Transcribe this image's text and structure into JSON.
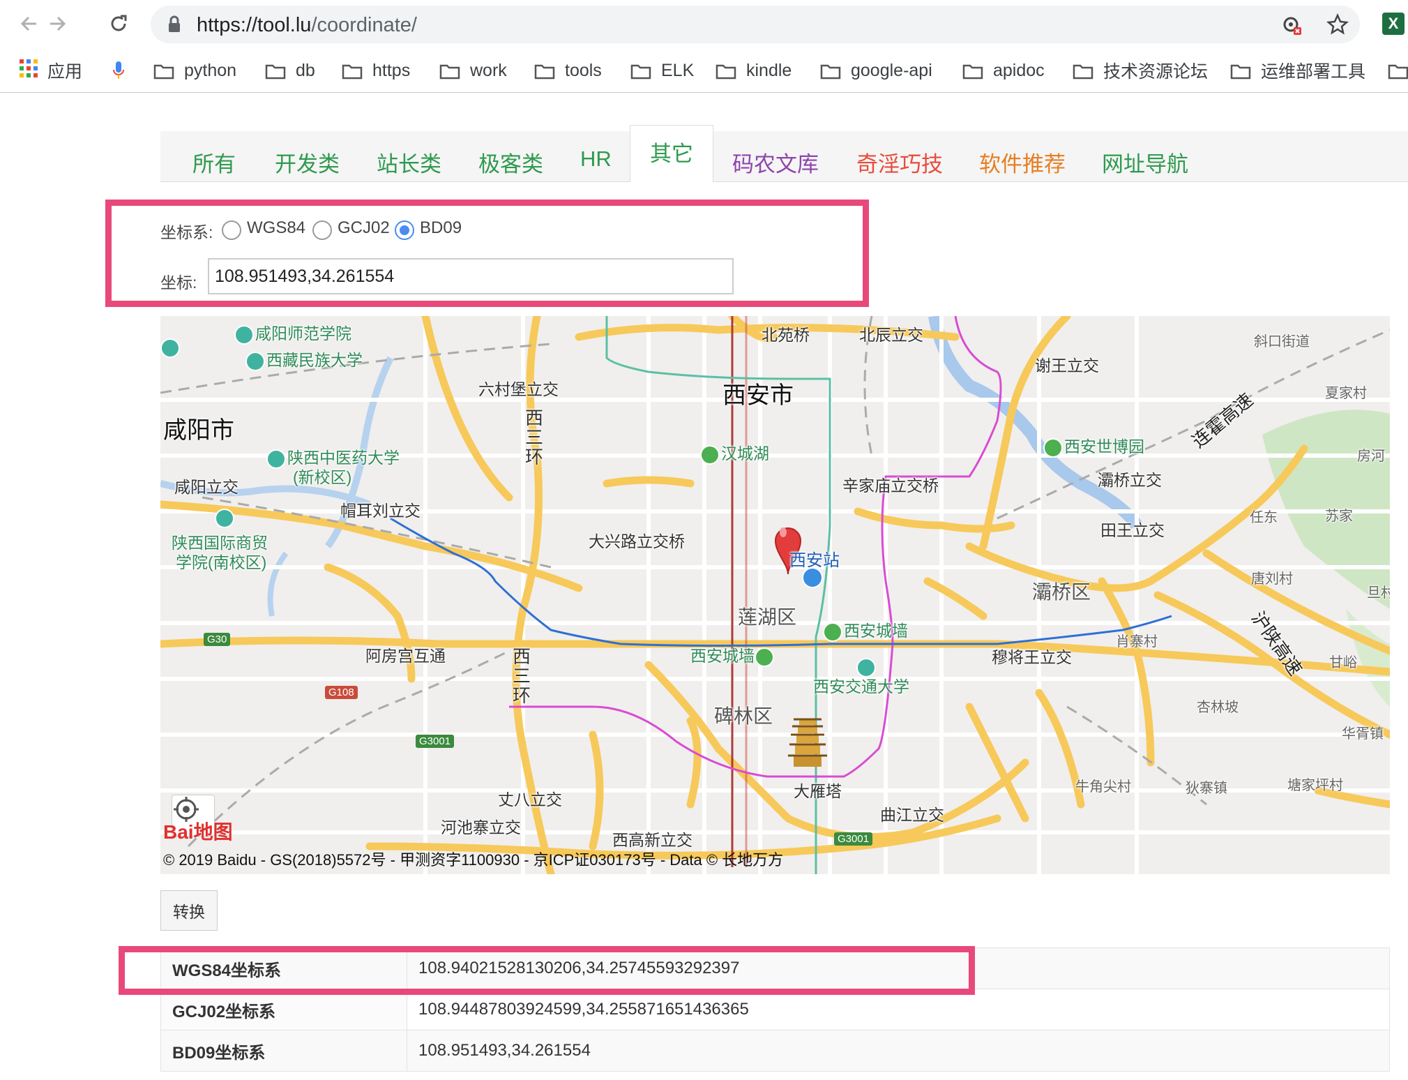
{
  "browser": {
    "url_host": "https://tool.lu",
    "url_path": "/coordinate/",
    "bookmarks": [
      "应用",
      "python",
      "db",
      "https",
      "work",
      "tools",
      "ELK",
      "kindle",
      "google-api",
      "apidoc",
      "技术资源论坛",
      "运维部署工具"
    ]
  },
  "tabs": [
    {
      "label": "所有",
      "color": "#2e9a4e"
    },
    {
      "label": "开发类",
      "color": "#2e9a4e"
    },
    {
      "label": "站长类",
      "color": "#2e9a4e"
    },
    {
      "label": "极客类",
      "color": "#2e9a4e"
    },
    {
      "label": "HR",
      "color": "#2e9a4e"
    },
    {
      "label": "其它",
      "color": "#2e9a4e"
    },
    {
      "label": "码农文库",
      "color": "#8e44ad"
    },
    {
      "label": "奇淫巧技",
      "color": "#e74c3c"
    },
    {
      "label": "软件推荐",
      "color": "#e67e22"
    },
    {
      "label": "网址导航",
      "color": "#2e9a4e"
    }
  ],
  "form": {
    "system_label": "坐标系:",
    "options": [
      "WGS84",
      "GCJ02",
      "BD09"
    ],
    "selected": "BD09",
    "coord_label": "坐标:",
    "coord_value": "108.951493,34.261554"
  },
  "map": {
    "labels": {
      "xianyang_normal": "咸阳师范学院",
      "xizang_univ": "西藏民族大学",
      "liucunbao": "六村堡立交",
      "beiyuanqiao": "北苑桥",
      "beichen": "北辰立交",
      "xiewang": "谢王立交",
      "xiejiecun": "斜口街道",
      "xiajiacun": "夏家村",
      "xian_city": "西安市",
      "xianyang_city": "咸阳市",
      "xisanhuan": "西三环",
      "lianhuo": "连霍高速",
      "hancheng_lake": "汉城湖",
      "expo": "西安世博园",
      "fanghe": "房河",
      "shaanxi_tcm": "陕西中医药大学",
      "shaanxi_tcm_sub": "(新校区)",
      "baqiao_interchange": "灞桥立交",
      "xianyang_interchange": "咸阳立交",
      "xinjiamiao": "辛家庙立交桥",
      "rendong": "任东",
      "sujia": "苏家",
      "maoerliu": "帽耳刘立交",
      "tianwang": "田王立交",
      "business_college": "陕西国际商贸",
      "business_college_sub": "学院(南校区)",
      "daxinglu": "大兴路立交桥",
      "xian_station": "西安站",
      "tangliucun": "唐刘村",
      "dan": "旦村",
      "baqiao_district": "灞桥区",
      "lianhu_district": "莲湖区",
      "city_wall_poi": "西安城墙",
      "hushan": "沪陕高速",
      "epang": "阿房宫互通",
      "xisanhuan2": "西三环",
      "city_wall": "西安城墙",
      "muwang": "穆将王立交",
      "xiaozhaicun": "肖寨村",
      "ganyu": "甘峪",
      "jiaotong": "西安交通大学",
      "xinglinpo": "杏林坡",
      "beilin": "碑林区",
      "huaxu": "华胥镇",
      "niujiaojian": "牛角尖村",
      "dizhai": "狄寨镇",
      "tangjiaping": "塘家坪村",
      "dayanta": "大雁塔",
      "zhangba": "丈八立交",
      "qujiang": "曲江立交",
      "hechizhai": "河池寨立交",
      "xigaoxin": "西高新立交",
      "g30": "G30",
      "g108": "G108",
      "g3001a": "G3001",
      "g3001b": "G3001"
    },
    "copyright": "© 2019 Baidu - GS(2018)5572号 - 甲测资字1100930 - 京ICP证030173号 - Data © 长地万方",
    "logo": "Bai地图"
  },
  "convert_label": "转换",
  "results": [
    {
      "key": "WGS84坐标系",
      "value": "108.94021528130206,34.25745593292397"
    },
    {
      "key": "GCJ02坐标系",
      "value": "108.94487803924599,34.255871651436365"
    },
    {
      "key": "BD09坐标系",
      "value": "108.951493,34.261554"
    }
  ]
}
